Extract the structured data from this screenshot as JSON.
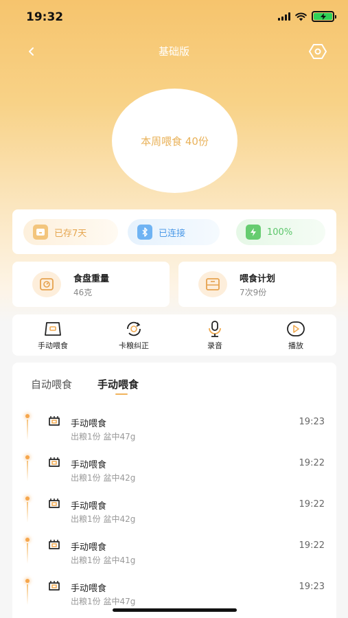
{
  "status_bar": {
    "time": "19:32",
    "icons": [
      "cellular-signal-icon",
      "wifi-icon",
      "battery-charging-icon"
    ],
    "battery_color": "#2fd158"
  },
  "nav": {
    "title": "基础版",
    "back_icon": "chevron-left-icon",
    "settings_icon": "hexagon-settings-icon"
  },
  "summary": {
    "week_feeding": "本周喂食 40份"
  },
  "device_status": {
    "storage": {
      "label": "已存7天",
      "icon": "storage-box-icon",
      "color": "#e5a650"
    },
    "bluetooth": {
      "label": "已连接",
      "icon": "bluetooth-icon",
      "color": "#4d9ae8"
    },
    "battery": {
      "label": "100%",
      "icon": "battery-charging-icon",
      "color": "#5bc66a"
    }
  },
  "info": {
    "plate_weight": {
      "title": "食盘重量",
      "value": "46克",
      "icon": "scale-icon"
    },
    "feeding_plan": {
      "title": "喂食计划",
      "value": "7次9份",
      "icon": "calendar-icon"
    }
  },
  "actions": [
    {
      "label": "手动喂食",
      "icon": "food-bowl-icon"
    },
    {
      "label": "卡粮纠正",
      "icon": "rotate-fix-icon"
    },
    {
      "label": "录音",
      "icon": "microphone-icon"
    },
    {
      "label": "播放",
      "icon": "play-icon"
    }
  ],
  "tabs": {
    "auto": "自动喂食",
    "manual": "手动喂食",
    "active": "manual",
    "accent": "#f0b35c"
  },
  "records": [
    {
      "title": "手动喂食",
      "detail": "出粮1份 盆中47g",
      "time": "19:23"
    },
    {
      "title": "手动喂食",
      "detail": "出粮1份 盆中42g",
      "time": "19:22"
    },
    {
      "title": "手动喂食",
      "detail": "出粮1份 盆中42g",
      "time": "19:22"
    },
    {
      "title": "手动喂食",
      "detail": "出粮1份 盆中41g",
      "time": "19:22"
    },
    {
      "title": "手动喂食",
      "detail": "出粮1份 盆中47g",
      "time": "19:23"
    }
  ]
}
